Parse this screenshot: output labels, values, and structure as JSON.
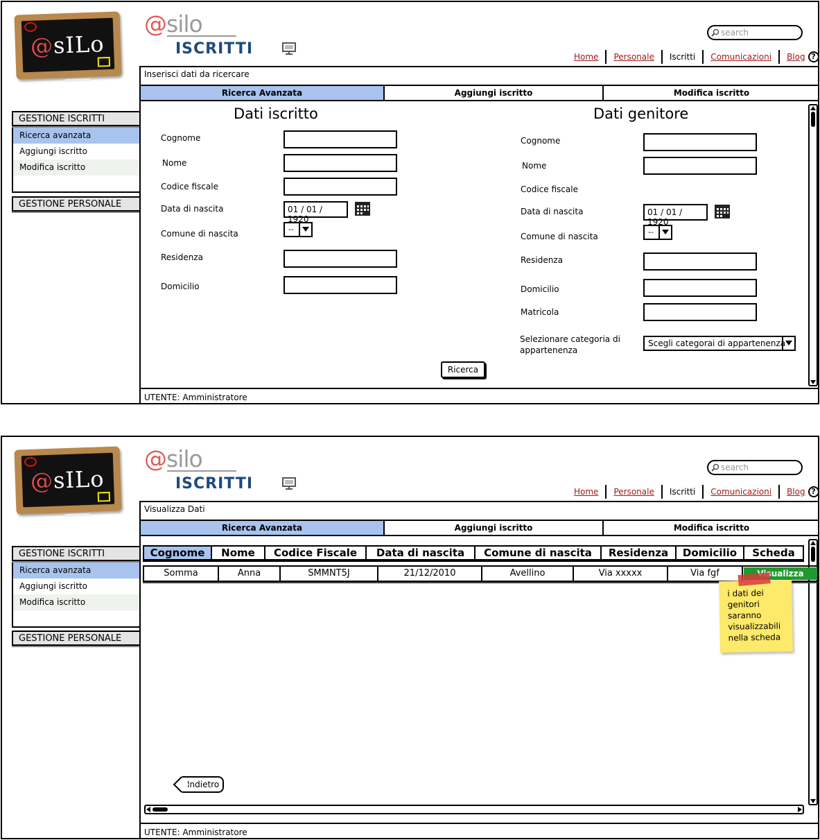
{
  "header": {
    "brand_at": "@",
    "brand_rest": "silo",
    "logo_text_at": "@",
    "logo_text_rest": "sILo",
    "title": "ISCRITTI",
    "search_placeholder": "search"
  },
  "nav": {
    "items": [
      "Home",
      "Personale",
      "Iscritti",
      "Comunicazioni",
      "Blog"
    ],
    "current": "Iscritti",
    "help": "?"
  },
  "tabs": [
    "Ricerca Avanzata",
    "Aggiungi iscritto",
    "Modifica iscritto"
  ],
  "sidebar": {
    "group1": "GESTIONE ISCRITTI",
    "items": [
      "Ricerca avanzata",
      "Aggiungi iscritto",
      "Modifica iscritto"
    ],
    "group2": "GESTIONE PERSONALE"
  },
  "status": "UTENTE: Amministratore",
  "colors": {
    "tab_active": "#a8c4ee",
    "link": "#a01818",
    "title": "#1f4a7b",
    "view_button": "#1f9a2d",
    "note": "#fde96a"
  },
  "screen1": {
    "crumb": "Inserisci dati da ricercare",
    "left_title": "Dati iscritto",
    "right_title": "Dati genitore",
    "labels": {
      "cognome": "Cognome",
      "nome": "Nome",
      "codice_fiscale": "Codice fiscale",
      "data_nascita": "Data di nascita",
      "comune_nascita": "Comune di nascita",
      "residenza": "Residenza",
      "domicilio": "Domicilio",
      "matricola": "Matricola",
      "categoria": "Selezionare categoria di appartenenza"
    },
    "date_value": "01 / 01 / 1920",
    "combo_value": "--",
    "category_placeholder": "Scegli categorai di appartenenza",
    "search_button": "Ricerca"
  },
  "screen2": {
    "crumb": "Visualizza Dati",
    "columns": [
      "Cognome",
      "Nome",
      "Codice Fiscale",
      "Data di nascita",
      "Comune di nascita",
      "Residenza",
      "Domicilio",
      "Scheda"
    ],
    "rows": [
      [
        "Somma",
        "Anna",
        "SMMNT5J",
        "21/12/2010",
        "Avellino",
        "Via xxxxx",
        "Via fgf",
        "Visualizza"
      ]
    ],
    "note": "i dati dei genitori saranno visualizzabili nella scheda",
    "back_button": "Indietro"
  }
}
